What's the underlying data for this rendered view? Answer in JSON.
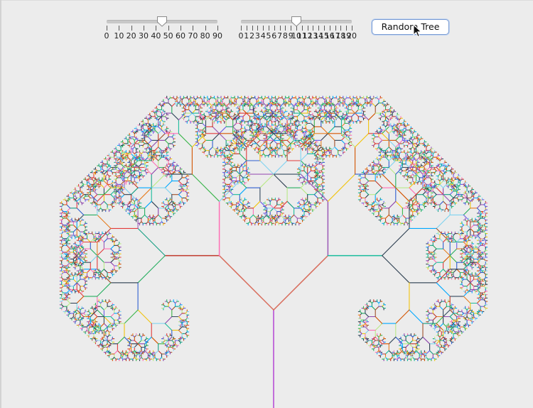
{
  "slider_angle": {
    "tick_labels": [
      "0",
      "10",
      "20",
      "30",
      "40",
      "50",
      "60",
      "70",
      "80",
      "90"
    ],
    "value": 45,
    "min": 0,
    "max": 90
  },
  "slider_depth": {
    "tick_labels": [
      "0",
      "1",
      "2",
      "3",
      "4",
      "5",
      "6",
      "7",
      "8",
      "9",
      "10",
      "11",
      "12",
      "13",
      "14",
      "15",
      "16",
      "17",
      "18",
      "19",
      "20"
    ],
    "value": 10,
    "min": 0,
    "max": 20
  },
  "random_button": {
    "label": "Random Tree"
  },
  "tree": {
    "branch_angle_deg": 45,
    "depth": 10,
    "trunk_color": "#b84fd6",
    "first_branch_color": "#d86b5a",
    "colors": [
      "#e23b3b",
      "#3bb54a",
      "#2f5fd0",
      "#9b59b6",
      "#f1c40f",
      "#1abc9c",
      "#34495e",
      "#e67e22",
      "#7fd3f0",
      "#c0392b",
      "#8e44ad",
      "#27ae60",
      "#d35400",
      "#16a085",
      "#2c3e50",
      "#b8e986",
      "#ff6fb5",
      "#6c5ce7",
      "#a0522d",
      "#00a8ff"
    ]
  },
  "icons": {
    "cursor": "arrow-cursor-icon"
  }
}
